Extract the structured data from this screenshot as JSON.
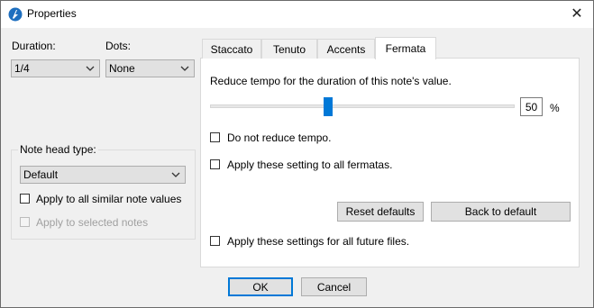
{
  "window": {
    "title": "Properties",
    "close_icon": "close-icon"
  },
  "duration": {
    "label": "Duration:",
    "value": "1/4"
  },
  "dots": {
    "label": "Dots:",
    "value": "None"
  },
  "note_head": {
    "group_label": "Note head type:",
    "value": "Default",
    "apply_similar": "Apply to all similar note values",
    "apply_selected": "Apply to selected notes"
  },
  "tabs": [
    {
      "label": "Staccato"
    },
    {
      "label": "Tenuto"
    },
    {
      "label": "Accents"
    },
    {
      "label": "Fermata"
    }
  ],
  "fermata": {
    "description": "Reduce tempo for the duration of this note's value.",
    "slider_value": 50,
    "value_text": "50",
    "unit": "%",
    "no_reduce": "Do not reduce tempo.",
    "apply_all_fermatas": "Apply these setting to all fermatas.",
    "reset_defaults": "Reset defaults",
    "back_to_default": "Back to default",
    "apply_future": "Apply these settings for all future files."
  },
  "buttons": {
    "ok": "OK",
    "cancel": "Cancel"
  },
  "colors": {
    "accent": "#0078d7"
  }
}
